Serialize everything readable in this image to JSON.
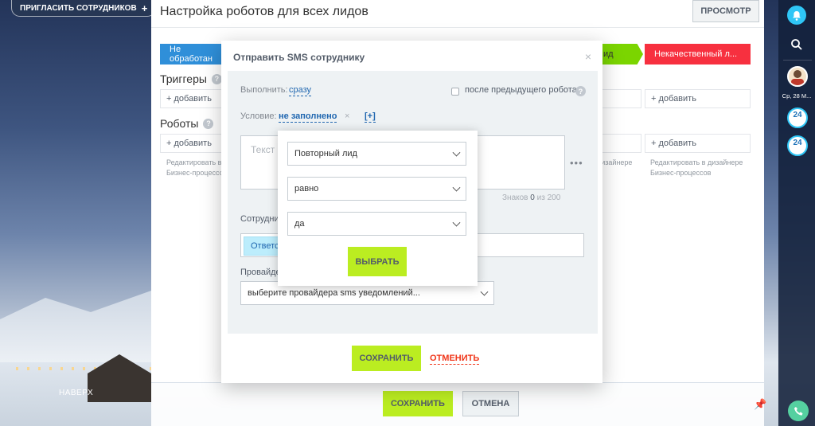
{
  "top": {
    "invite_label": "ПРИГЛАСИТЬ СОТРУДНИКОВ",
    "invite_plus": "+",
    "naverh": "НАВЕРХ"
  },
  "page": {
    "title": "Настройка роботов для всех лидов",
    "preview_button": "ПРОСМОТР",
    "stages": [
      "Не обработан",
      "ид",
      "Некачественный л..."
    ],
    "triggers_title": "Триггеры",
    "robots_title": "Роботы",
    "help": "?",
    "add_label": "+ добавить",
    "designer_text": "Редактировать в дизайнере Бизнес-процессов",
    "designer_text_short": "Редактировать в",
    "designer_text_line2": "Бизнес-процессов",
    "designer_right_line1": "дизайнере"
  },
  "bottom": {
    "save": "СОХРАНИТЬ",
    "cancel": "ОТМЕНА"
  },
  "right_panel": {
    "date": "Ср, 28 М...",
    "badge": "24"
  },
  "popup": {
    "title": "Отправить SMS сотруднику",
    "close": "×",
    "execute_label": "Выполнить:",
    "execute_value": "сразу",
    "after_prev": "после предыдущего робота",
    "condition_label": "Условие:",
    "condition_value": "не заполнено",
    "condition_x": "×",
    "condition_add": "[+]",
    "text_placeholder": "Текст",
    "chars_label": "Знаков",
    "chars_value": "0",
    "chars_of": "из",
    "chars_max": "200",
    "employee_label": "Сотрудни",
    "employee_tag": "Ответс",
    "provider_label": "Провайде",
    "provider_value": "выберите провайдера sms уведомлений...",
    "save": "СОХРАНИТЬ",
    "cancel": "ОТМЕНИТЬ"
  },
  "condition_dropdown": {
    "field": "Повторный лид",
    "operator": "равно",
    "value": "да",
    "select_button": "ВЫБРАТЬ"
  },
  "colors": {
    "accent_green": "#bbed21",
    "blue": "#2f8fd9",
    "red": "#f7303f",
    "link": "#2067b0"
  }
}
